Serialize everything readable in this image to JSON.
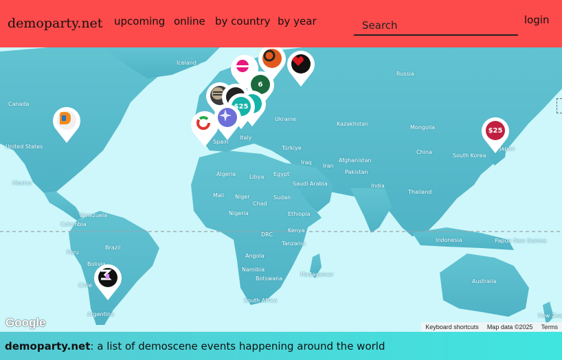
{
  "header": {
    "brand": "demoparty.net",
    "nav": [
      "upcoming",
      "online",
      "by country",
      "by year"
    ],
    "search_placeholder": "Search",
    "login": "login"
  },
  "map": {
    "labels": {
      "iceland": "Iceland",
      "russia": "Russia",
      "canada": "Canada",
      "united_states": "United States",
      "mexico": "Mexico",
      "ukraine": "Ukraine",
      "kazakhstan": "Kazakhstan",
      "mongolia": "Mongolia",
      "china": "China",
      "south_korea": "South Korea",
      "japan": "Japan",
      "spain": "Spain",
      "italy": "Italy",
      "turkiye": "Türkiye",
      "iraq": "Iraq",
      "iran": "Iran",
      "afghanistan": "Afghanistan",
      "pakistan": "Pakistan",
      "india": "India",
      "thailand": "Thailand",
      "algeria": "Algeria",
      "libya": "Libya",
      "egypt": "Egypt",
      "saudi_arabia": "Saudi Arabia",
      "mali": "Mali",
      "niger": "Niger",
      "chad": "Chad",
      "sudan": "Sudan",
      "nigeria": "Nigeria",
      "ethiopia": "Ethiopia",
      "kenya": "Kenya",
      "drc": "DRC",
      "tanzania": "Tanzania",
      "angola": "Angola",
      "namibia": "Namibia",
      "botswana": "Botswana",
      "madagascar": "Madagascar",
      "south_africa": "South Africa",
      "venezuela": "Venezuela",
      "colombia": "Colombia",
      "peru": "Peru",
      "brazil": "Brazil",
      "bolivia": "Bolivia",
      "chile": "Chile",
      "argentina": "Argentina",
      "indonesia": "Indonesia",
      "papua_new_guinea": "Papua New Guinea",
      "australia": "Australia",
      "new_zealand": "New Zealand"
    },
    "markers": {
      "japan_price": "$25",
      "europe_price": "$25"
    },
    "google_logo": "Google",
    "attribution": {
      "shortcuts": "Keyboard shortcuts",
      "map_data": "Map data ©2025",
      "terms": "Terms"
    }
  },
  "footer": {
    "brand": "demoparty.net",
    "tagline": ": a list of demoscene events happening around the world"
  },
  "colors": {
    "header_bg": "#fd4a4a",
    "ocean": "#cdf7fa",
    "land": "#5bbdcc",
    "marker_red": "#c0203f",
    "marker_teal": "#15b3a8"
  }
}
